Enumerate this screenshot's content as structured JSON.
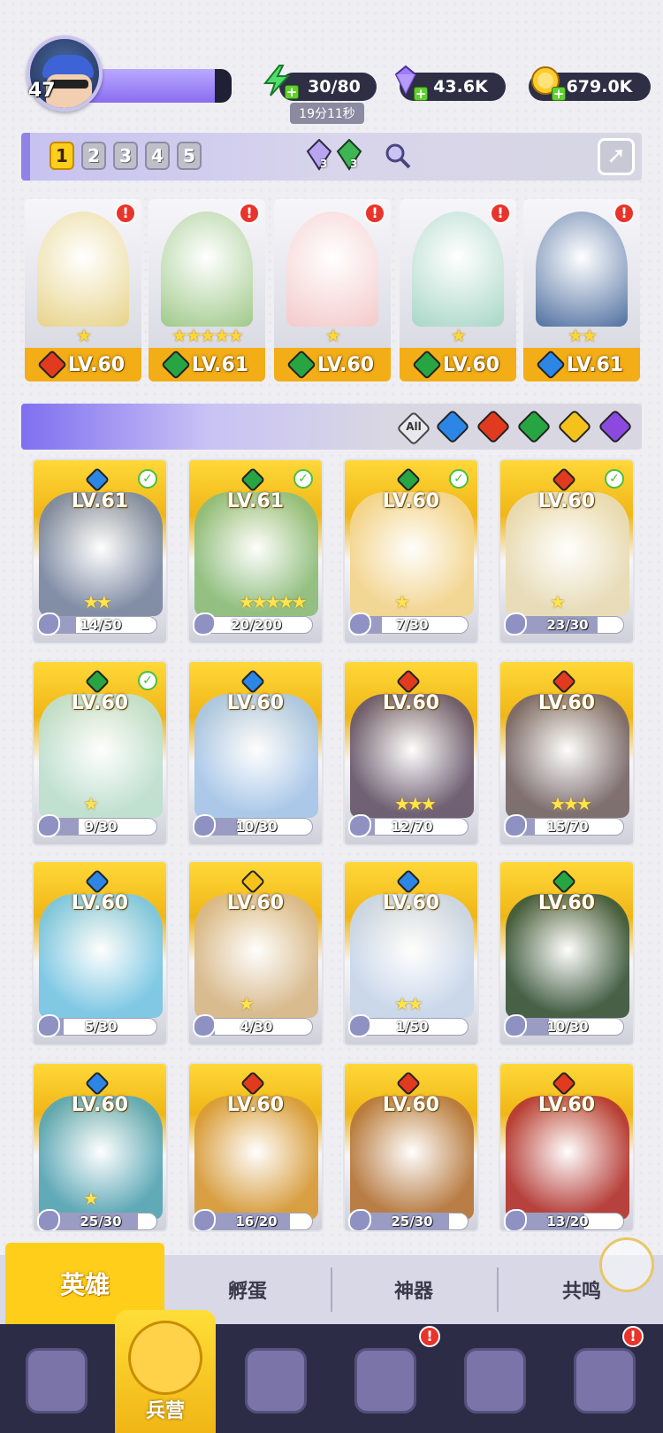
{
  "player": {
    "level": "47",
    "xp_fraction": 0.88
  },
  "resources": {
    "energy": "30/80",
    "energy_timer": "19分11秒",
    "gems": "43.6K",
    "gold": "679.0K"
  },
  "team_tabs": [
    "1",
    "2",
    "3",
    "4",
    "5"
  ],
  "team_active": "1",
  "team_gem_counts": [
    "3",
    "3"
  ],
  "team": [
    {
      "level": "LV.60",
      "element": "fire",
      "stars": "★",
      "color": "#e7d38a"
    },
    {
      "level": "LV.61",
      "element": "wind",
      "stars": "★★★★★",
      "color": "#9fc989"
    },
    {
      "level": "LV.60",
      "element": "wind",
      "stars": "★",
      "color": "#f4c9c9"
    },
    {
      "level": "LV.60",
      "element": "wind",
      "stars": "★",
      "color": "#a8d6c6"
    },
    {
      "level": "LV.61",
      "element": "water",
      "stars": "★★",
      "color": "#4f6fa0"
    }
  ],
  "filters": {
    "all_label": "All",
    "elements": [
      "water",
      "fire",
      "wind",
      "light",
      "dark"
    ]
  },
  "heroes": [
    {
      "level": "LV.61",
      "element": "water",
      "shards": "14/50",
      "fill": 0.28,
      "checked": true,
      "stars": "★★",
      "color": "#7d8aa3"
    },
    {
      "level": "LV.61",
      "element": "wind",
      "shards": "20/200",
      "fill": 0.1,
      "checked": true,
      "stars": "★★★★★",
      "color": "#8fbe7c"
    },
    {
      "level": "LV.60",
      "element": "wind",
      "shards": "7/30",
      "fill": 0.23,
      "checked": true,
      "stars": "★",
      "color": "#f3d58f"
    },
    {
      "level": "LV.60",
      "element": "fire",
      "shards": "23/30",
      "fill": 0.77,
      "checked": true,
      "stars": "★",
      "color": "#e8dcb6"
    },
    {
      "level": "LV.60",
      "element": "wind",
      "shards": "9/30",
      "fill": 0.3,
      "checked": true,
      "stars": "★",
      "color": "#bfe0cf"
    },
    {
      "level": "LV.60",
      "element": "water",
      "shards": "10/30",
      "fill": 0.33,
      "checked": false,
      "stars": "",
      "color": "#a9c7e8"
    },
    {
      "level": "LV.60",
      "element": "fire",
      "shards": "12/70",
      "fill": 0.17,
      "checked": false,
      "stars": "★★★",
      "color": "#6b5a6e"
    },
    {
      "level": "LV.60",
      "element": "fire",
      "shards": "15/70",
      "fill": 0.21,
      "checked": false,
      "stars": "★★★",
      "color": "#7a6a6a"
    },
    {
      "level": "LV.60",
      "element": "water",
      "shards": "5/30",
      "fill": 0.17,
      "checked": false,
      "stars": "",
      "color": "#7bc7e3"
    },
    {
      "level": "LV.60",
      "element": "light",
      "shards": "4/30",
      "fill": 0.13,
      "checked": false,
      "stars": "★",
      "color": "#d8b98a"
    },
    {
      "level": "LV.60",
      "element": "water",
      "shards": "1/50",
      "fill": 0.02,
      "checked": false,
      "stars": "★★",
      "color": "#c9d7ea"
    },
    {
      "level": "LV.60",
      "element": "wind",
      "shards": "10/30",
      "fill": 0.33,
      "checked": false,
      "stars": "",
      "color": "#3f5a3e"
    },
    {
      "level": "LV.60",
      "element": "water",
      "shards": "25/30",
      "fill": 0.83,
      "checked": false,
      "stars": "★",
      "color": "#5aa7b5"
    },
    {
      "level": "LV.60",
      "element": "fire",
      "shards": "16/20",
      "fill": 0.8,
      "checked": false,
      "stars": "",
      "color": "#d89c3a"
    },
    {
      "level": "LV.60",
      "element": "fire",
      "shards": "25/30",
      "fill": 0.83,
      "checked": false,
      "stars": "",
      "color": "#b7793e"
    },
    {
      "level": "LV.60",
      "element": "fire",
      "shards": "13/20",
      "fill": 0.65,
      "checked": false,
      "stars": "",
      "color": "#b53a34"
    }
  ],
  "sub_tabs": [
    "英雄",
    "孵蛋",
    "神器",
    "共鸣"
  ],
  "nav": {
    "active_label": "兵营"
  },
  "icons": {
    "energy": "lightning-icon",
    "gems": "diamond-icon",
    "gold": "coin-icon",
    "share": "share-icon",
    "alert": "exclamation-icon",
    "check": "check-icon"
  },
  "colors": {
    "accent": "#ffce1a",
    "panel": "#2c2c47",
    "purple": "#8a6df0"
  }
}
